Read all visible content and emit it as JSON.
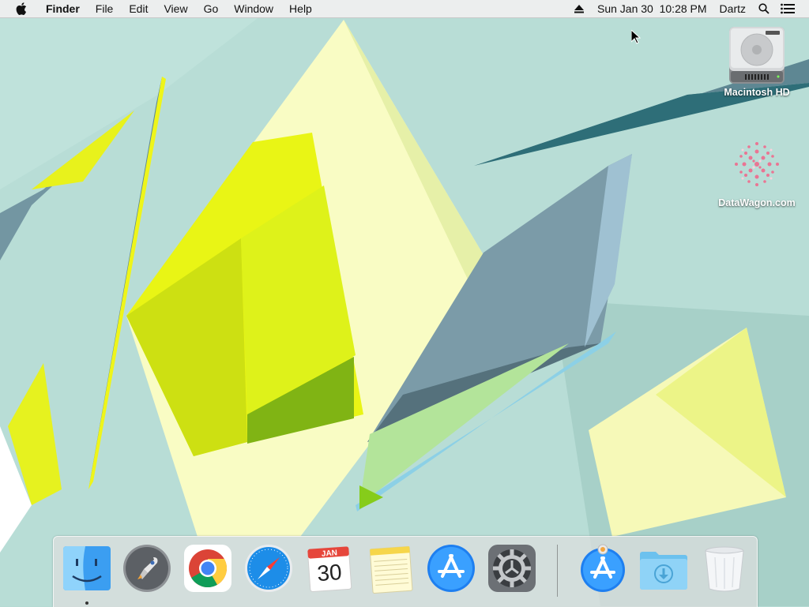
{
  "menubar": {
    "app_name": "Finder",
    "menus": [
      "File",
      "Edit",
      "View",
      "Go",
      "Window",
      "Help"
    ],
    "clock": "Sun Jan 30  10:28 PM",
    "user": "Dartz",
    "icons": [
      "apple-icon",
      "eject-icon",
      "spotlight-search-icon",
      "notification-center-icon"
    ]
  },
  "desktop": {
    "icons": [
      {
        "label": "Macintosh HD",
        "icon": "hard-drive-icon"
      },
      {
        "label": "DataWagon.com",
        "icon": "network-volume-icon"
      }
    ]
  },
  "dock": {
    "apps": [
      {
        "name": "Finder",
        "icon": "finder-icon",
        "running": true
      },
      {
        "name": "Launchpad",
        "icon": "launchpad-rocket-icon",
        "running": false
      },
      {
        "name": "Google Chrome",
        "icon": "chrome-icon",
        "running": false
      },
      {
        "name": "Safari",
        "icon": "safari-compass-icon",
        "running": false
      },
      {
        "name": "Calendar",
        "icon": "calendar-icon",
        "running": false,
        "month": "JAN",
        "day": "30"
      },
      {
        "name": "Notes",
        "icon": "notes-icon",
        "running": false
      },
      {
        "name": "App Store",
        "icon": "app-store-icon",
        "running": false
      },
      {
        "name": "System Preferences",
        "icon": "gear-icon",
        "running": false
      }
    ],
    "others": [
      {
        "name": "App Store Installer",
        "icon": "app-store-download-icon"
      },
      {
        "name": "Downloads",
        "icon": "downloads-folder-icon"
      },
      {
        "name": "Trash",
        "icon": "trash-icon"
      }
    ]
  },
  "colors": {
    "wallpaper_base": "#b6dbd4",
    "accent_yellow": "#eef51a",
    "accent_slate": "#5e8793"
  }
}
